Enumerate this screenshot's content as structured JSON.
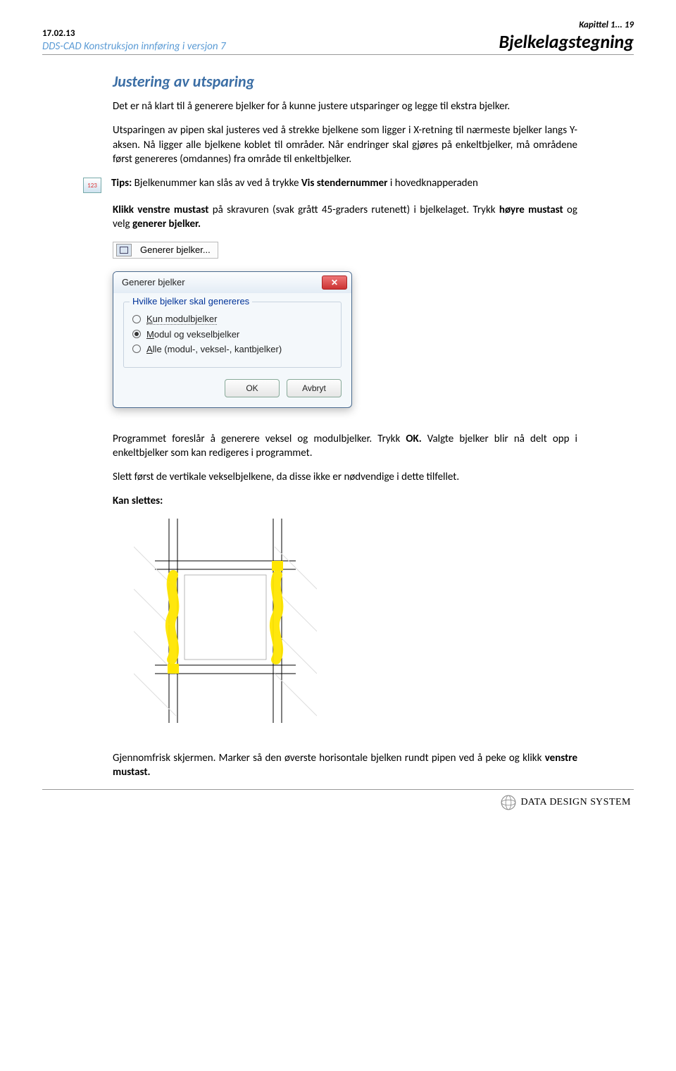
{
  "header": {
    "date": "17.02.13",
    "subtitle": "DDS-CAD Konstruksjon  innføring i versjon 7",
    "chapter": "Kapittel 1... 19",
    "doc_title": "Bjelkelagstegning"
  },
  "section_title": "Justering av utsparing",
  "para1": "Det er nå klart til å generere bjelker for å kunne justere utsparinger og legge til ekstra bjelker.",
  "para2": "Utsparingen av pipen skal justeres ved å strekke bjelkene som ligger i X-retning til nærmeste bjelker langs Y-aksen. Nå ligger alle bjelkene koblet til områder. Når endringer skal gjøres på enkeltbjelker, må områdene først genereres (omdannes) fra område til enkeltbjelker.",
  "tips_icon_label": "123",
  "tips_before": "Tips:",
  "tips_mid1": " Bjelkenummer kan slås av ved å trykke ",
  "tips_bold": "Vis stendernummer",
  "tips_mid2": " i hovedknapperaden",
  "para3a": "Klikk venstre mustast",
  "para3b": " på skravuren (svak grått 45-graders rutenett) i bjelkelaget. Trykk ",
  "para3c": "høyre mustast",
  "para3d": " og velg ",
  "para3e": "generer bjelker.",
  "menu_item": "Generer bjelker...",
  "dialog": {
    "title": "Generer bjelker",
    "legend": "Hvilke bjelker skal genereres",
    "opt1": "Kun modulbjelker",
    "opt2": "Modul og vekselbjelker",
    "opt3": "Alle (modul-, veksel-, kantbjelker)",
    "ok": "OK",
    "cancel": "Avbryt"
  },
  "para4a": "Programmet foreslår å generere veksel og modulbjelker. Trykk ",
  "para4b": "OK.",
  "para4c": " Valgte bjelker blir nå delt opp i enkeltbjelker som kan redigeres i programmet.",
  "para5": "Slett først de vertikale vekselbjelkene, da disse ikke er nødvendige i dette tilfellet.",
  "label_can_delete": "Kan slettes:",
  "para6a": "Gjennomfrisk skjermen. Marker så den øverste horisontale bjelken rundt pipen ved å peke og klikk ",
  "para6b": "venstre mustast.",
  "footer": {
    "brand1": "D",
    "brand2": "ATA ",
    "brand3": "D",
    "brand4": "ESIGN ",
    "brand5": "S",
    "brand6": "YSTEM"
  }
}
